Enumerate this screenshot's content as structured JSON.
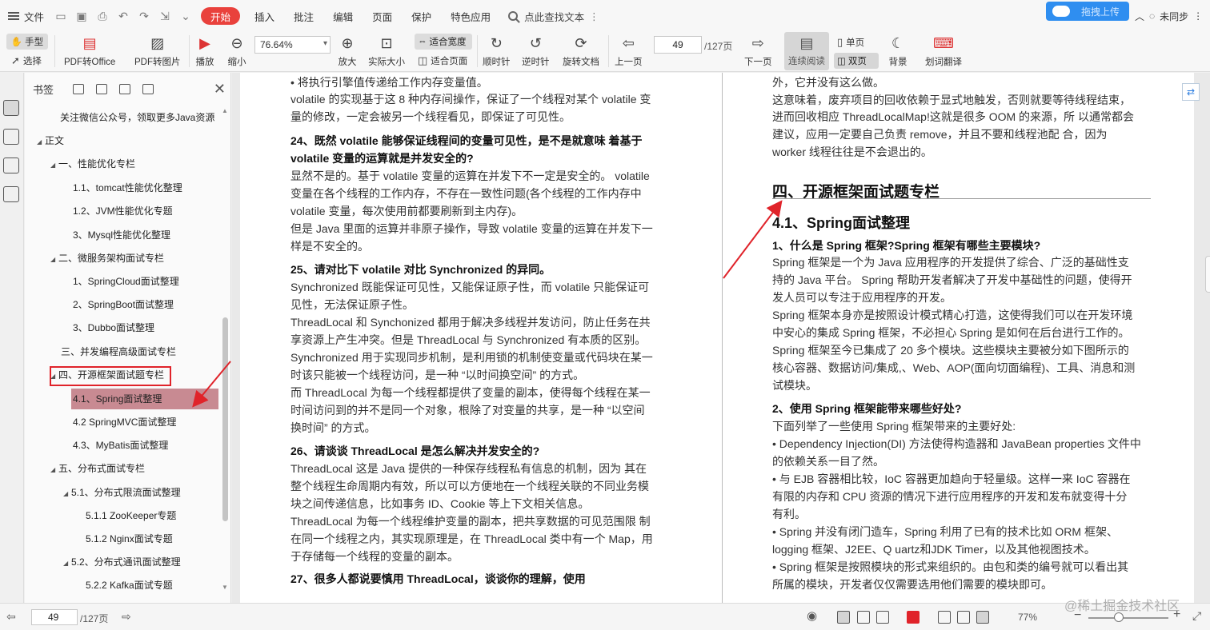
{
  "menubar": {
    "file": "文件",
    "tabs": [
      "开始",
      "插入",
      "批注",
      "编辑",
      "页面",
      "保护",
      "特色应用"
    ],
    "active_tab": "开始",
    "search": "点此查找文本",
    "upload": "拖拽上传",
    "sync": "未同步"
  },
  "toolbar": {
    "hand": "手型",
    "select": "选择",
    "pdf_to_office": "PDF转Office",
    "pdf_to_image": "PDF转图片",
    "play": "播放",
    "zoom_out": "缩小",
    "zoom_value": "76.64%",
    "zoom_in": "放大",
    "actual_size": "实际大小",
    "fit_width": "适合宽度",
    "fit_page": "适合页面",
    "rotate_cw": "顺时针",
    "rotate_ccw": "逆时针",
    "rotate_doc": "旋转文档",
    "prev_page": "上一页",
    "page_value": "49",
    "page_total": "/127页",
    "next_page": "下一页",
    "continuous": "连续阅读",
    "single": "单页",
    "double": "双页",
    "background": "背景",
    "translate": "划词翻译"
  },
  "bookmarks": {
    "title": "书签",
    "items": [
      {
        "label": "关注微信公众号，领取更多Java资源",
        "level": 0
      },
      {
        "label": "正文",
        "level": 0
      },
      {
        "label": "一、性能优化专栏",
        "level": 1
      },
      {
        "label": "1.1、tomcat性能优化整理",
        "level": 2
      },
      {
        "label": "1.2、JVM性能优化专题",
        "level": 2
      },
      {
        "label": "3、Mysql性能优化整理",
        "level": 2
      },
      {
        "label": "二、微服务架构面试专栏",
        "level": 1
      },
      {
        "label": "1、SpringCloud面试整理",
        "level": 2
      },
      {
        "label": "2、SpringBoot面试整理",
        "level": 2
      },
      {
        "label": "3、Dubbo面试整理",
        "level": 2
      },
      {
        "label": "三、并发编程高级面试专栏",
        "level": 1
      },
      {
        "label": "四、开源框架面试题专栏",
        "level": 1
      },
      {
        "label": "4.1、Spring面试整理",
        "level": 2
      },
      {
        "label": "4.2 SpringMVC面试整理",
        "level": 2
      },
      {
        "label": "4.3、MyBatis面试整理",
        "level": 2
      },
      {
        "label": "五、分布式面试专栏",
        "level": 1
      },
      {
        "label": "5.1、分布式限流面试整理",
        "level": 2
      },
      {
        "label": "5.1.1 ZooKeeper专题",
        "level": 3
      },
      {
        "label": "5.1.2 Nginx面试专题",
        "level": 3
      },
      {
        "label": "5.2、分布式通讯面试整理",
        "level": 2
      },
      {
        "label": "5.2.2 Kafka面试专题",
        "level": 3
      }
    ]
  },
  "left_page": {
    "lines": [
      {
        "text": "• 将执行引擎值传递给工作内存变量值。",
        "bold": false
      },
      {
        "text": "volatile 的实现基于这 8 种内存间操作，保证了一个线程对某个 volatile 变",
        "bold": false
      },
      {
        "text": "量的修改，一定会被另一个线程看见，即保证了可见性。",
        "bold": false
      },
      {
        "text": "24、既然 volatile 能够保证线程间的变量可见性，是不是就意味 着基于",
        "bold": true
      },
      {
        "text": "volatile 变量的运算就是并发安全的?",
        "bold": true
      },
      {
        "text": "显然不是的。基于 volatile 变量的运算在并发下不一定是安全的。 volatile",
        "bold": false
      },
      {
        "text": "变量在各个线程的工作内存，不存在一致性问题(各个线程的工作内存中",
        "bold": false
      },
      {
        "text": "volatile 变量，每次使用前都要刷新到主内存)。",
        "bold": false
      },
      {
        "text": "但是 Java 里面的运算并非原子操作，导致 volatile 变量的运算在并发下一",
        "bold": false
      },
      {
        "text": "样是不安全的。",
        "bold": false
      },
      {
        "text": "25、请对比下 volatile 对比 Synchronized 的异同。",
        "bold": true
      },
      {
        "text": "Synchronized 既能保证可见性，又能保证原子性，而 volatile 只能保证可",
        "bold": false
      },
      {
        "text": "见性，无法保证原子性。",
        "bold": false
      },
      {
        "text": "ThreadLocal 和 Synchonized 都用于解决多线程并发访问，防止任务在共",
        "bold": false
      },
      {
        "text": "享资源上产生冲突。但是 ThreadLocal 与 Synchronized 有本质的区别。",
        "bold": false
      },
      {
        "text": "Synchronized 用于实现同步机制，是利用锁的机制使变量或代码块在某一",
        "bold": false
      },
      {
        "text": "时该只能被一个线程访问，是一种 “以时间换空间” 的方式。",
        "bold": false
      },
      {
        "text": "而 ThreadLocal 为每一个线程都提供了变量的副本，使得每个线程在某一",
        "bold": false
      },
      {
        "text": "时间访问到的并不是同一个对象，根除了对变量的共享，是一种 “以空间",
        "bold": false
      },
      {
        "text": "换时间” 的方式。",
        "bold": false
      },
      {
        "text": "26、请谈谈 ThreadLocal 是怎么解决并发安全的?",
        "bold": true
      },
      {
        "text": "ThreadLocal 这是 Java 提供的一种保存线程私有信息的机制，因为 其在",
        "bold": false
      },
      {
        "text": "整个线程生命周期内有效，所以可以方便地在一个线程关联的不同业务模",
        "bold": false
      },
      {
        "text": "块之间传递信息，比如事务 ID、Cookie 等上下文相关信息。",
        "bold": false
      },
      {
        "text": "ThreadLocal 为每一个线程维护变量的副本，把共享数据的可见范围限 制",
        "bold": false
      },
      {
        "text": "在同一个线程之内，其实现原理是，在 ThreadLocal 类中有一个 Map，用",
        "bold": false
      },
      {
        "text": "于存储每一个线程的变量的副本。",
        "bold": false
      },
      {
        "text": "27、很多人都说要慎用 ThreadLocal，谈谈你的理解，使用",
        "bold": true
      }
    ]
  },
  "right_page": {
    "top_lines": [
      "外，它并没有这么做。",
      "这意味着，废弃项目的回收依赖于显式地触发，否则就要等待线程结束，",
      "进而回收相应 ThreadLocalMap!这就是很多 OOM 的来源，所 以通常都会",
      "建议，应用一定要自己负责 remove，并且不要和线程池配 合，因为",
      "worker 线程往往是不会退出的。"
    ],
    "h1": "四、开源框架面试题专栏",
    "h2": "4.1、Spring面试整理",
    "lines": [
      {
        "text": "1、什么是 Spring 框架?Spring 框架有哪些主要模块?",
        "bold": true
      },
      {
        "text": "Spring 框架是一个为 Java 应用程序的开发提供了综合、广泛的基础性支",
        "bold": false
      },
      {
        "text": "持的 Java 平台。 Spring 帮助开发者解决了开发中基础性的问题，使得开",
        "bold": false
      },
      {
        "text": "发人员可以专注于应用程序的开发。",
        "bold": false
      },
      {
        "text": "Spring 框架本身亦是按照设计模式精心打造，这使得我们可以在开发环境",
        "bold": false
      },
      {
        "text": "中安心的集成 Spring 框架，不必担心 Spring 是如何在后台进行工作的。",
        "bold": false
      },
      {
        "text": "Spring 框架至今已集成了 20 多个模块。这些模块主要被分如下图所示的",
        "bold": false
      },
      {
        "text": "核心容器、数据访问/集成,、Web、AOP(面向切面编程)、工具、消息和测",
        "bold": false
      },
      {
        "text": "试模块。",
        "bold": false
      },
      {
        "text": "2、使用 Spring 框架能带来哪些好处?",
        "bold": true
      },
      {
        "text": "下面列举了一些使用 Spring 框架带来的主要好处:",
        "bold": false
      },
      {
        "text": "• Dependency Injection(DI) 方法使得构造器和 JavaBean properties 文件中",
        "bold": false
      },
      {
        "text": "的依赖关系一目了然。",
        "bold": false
      },
      {
        "text": "• 与 EJB 容器相比较，IoC 容器更加趋向于轻量级。这样一来 IoC 容器在",
        "bold": false
      },
      {
        "text": "有限的内存和 CPU 资源的情况下进行应用程序的开发和发布就变得十分",
        "bold": false
      },
      {
        "text": "有利。",
        "bold": false
      },
      {
        "text": "• Spring 并没有闭门造车，Spring 利用了已有的技术比如 ORM 框架、",
        "bold": false
      },
      {
        "text": "logging 框架、J2EE、Q uartz和JDK Timer，以及其他视图技术。",
        "bold": false
      },
      {
        "text": "• Spring 框架是按照模块的形式来组织的。由包和类的编号就可以看出其",
        "bold": false
      },
      {
        "text": "所属的模块，开发者仅仅需要选用他们需要的模块即可。",
        "bold": false
      }
    ]
  },
  "statusbar": {
    "page_value": "49",
    "page_total": "/127页",
    "zoom": "77%"
  },
  "watermark": "@稀土掘金技术社区",
  "colors": {
    "accent_red": "#e9413c",
    "upload_blue": "#2f8ef0",
    "highlight": "#c88a92"
  }
}
